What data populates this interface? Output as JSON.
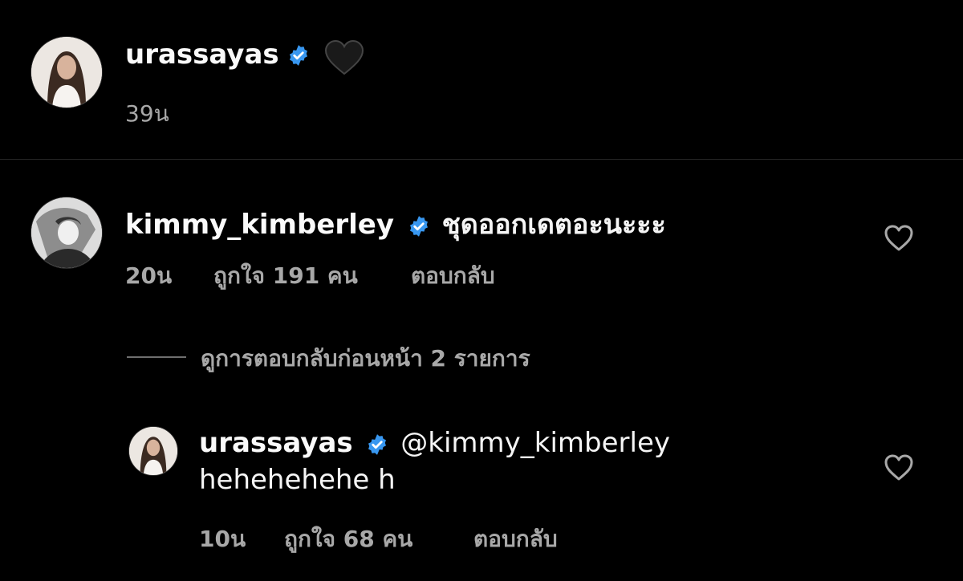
{
  "caption": {
    "username": "urassayas",
    "emoji": "🖤",
    "time": "39น"
  },
  "comment": {
    "username": "kimmy_kimberley",
    "text": "ชุดออกเดตอะนะะะ",
    "time": "20น",
    "likes": "ถูกใจ 191 คน",
    "reply_label": "ตอบกลับ"
  },
  "view_replies": {
    "label": "ดูการตอบกลับก่อนหน้า 2 รายการ"
  },
  "reply": {
    "username": "urassayas",
    "mention": "@kimmy_kimberley",
    "text": "hehehehehe h",
    "time": "10น",
    "likes": "ถูกใจ 68 คน",
    "reply_label": "ตอบกลับ"
  },
  "colors": {
    "background": "#000000",
    "verified": "#3897f0",
    "secondary_text": "#a8a8a8"
  }
}
